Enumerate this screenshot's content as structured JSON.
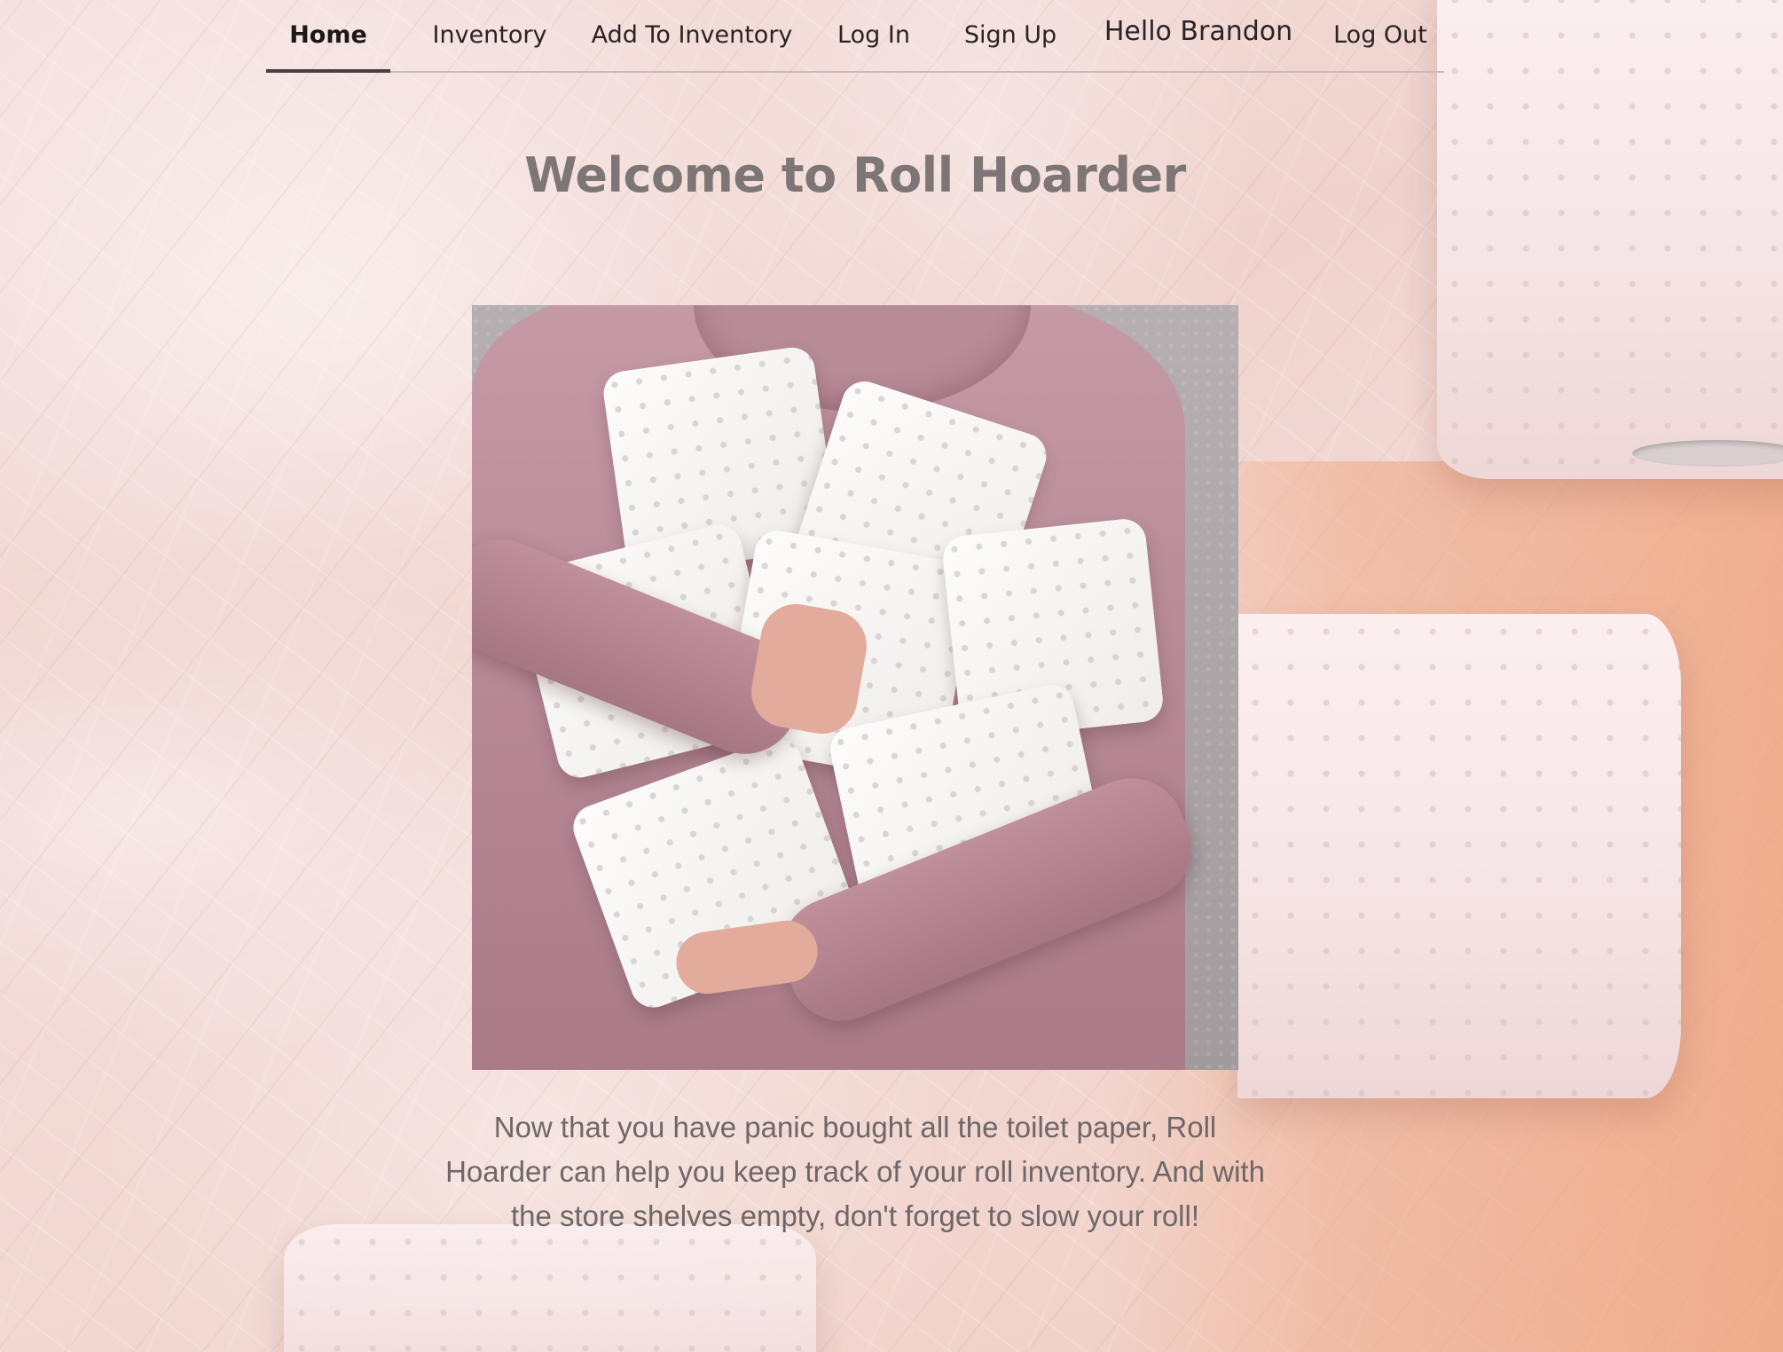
{
  "nav": {
    "home": "Home",
    "inventory": "Inventory",
    "add_to_inventory": "Add To Inventory",
    "log_in": "Log In",
    "sign_up": "Sign Up",
    "greeting": "Hello Brandon",
    "log_out": "Log Out"
  },
  "main": {
    "title": "Welcome to Roll Hoarder",
    "description": "Now that you have panic bought all the toilet paper, Roll Hoarder can help you keep track of your roll inventory. And with the store shelves empty, don't forget to slow your roll!"
  },
  "colors": {
    "background": "#f3dcd9",
    "title": "#7d7576",
    "text": "#6e6668",
    "nav_text": "#2a2326",
    "nav_underline": "#4a3f43"
  }
}
